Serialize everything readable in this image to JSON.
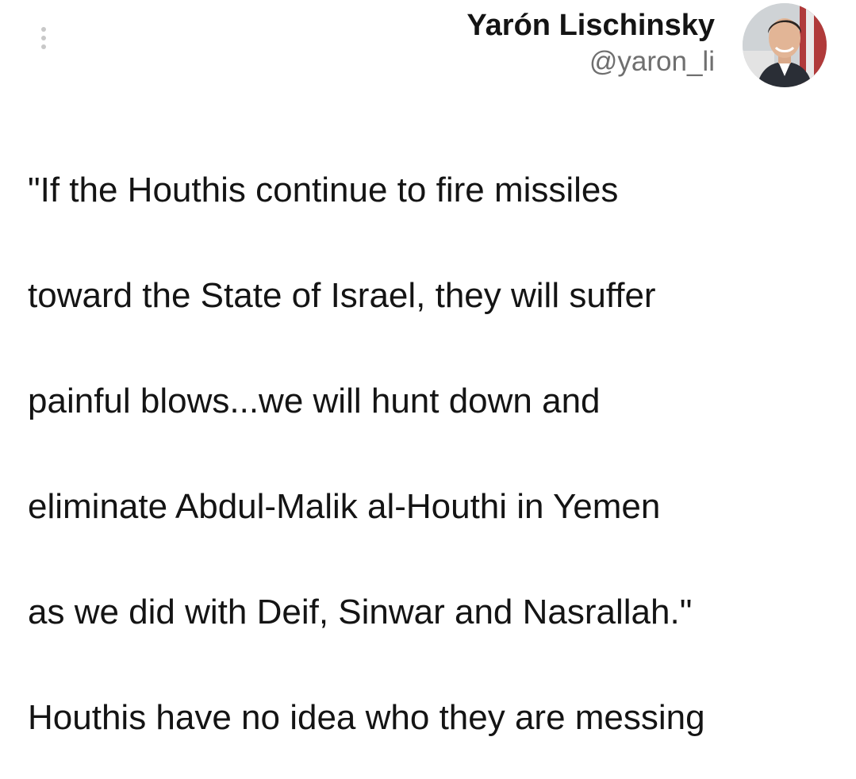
{
  "menu": {
    "icon": "more-vertical-icon"
  },
  "author": {
    "display_name": "Yarón Lischinsky",
    "handle": "@yaron_li",
    "avatar_icon": "profile-photo"
  },
  "tweet": {
    "lines": [
      "\"If the Houthis continue to fire missiles",
      "toward the State of Israel, they will suffer",
      "painful blows...we will hunt down and",
      "eliminate Abdul-Malik al-Houthi in Yemen",
      "as we did with Deif, Sinwar and Nasrallah.\"",
      "Houthis have no idea who they are messing"
    ]
  },
  "colors": {
    "text": "#141414",
    "secondary_text": "#6f6f6f",
    "background": "#ffffff",
    "menu_dots": "#c8c8c8"
  }
}
